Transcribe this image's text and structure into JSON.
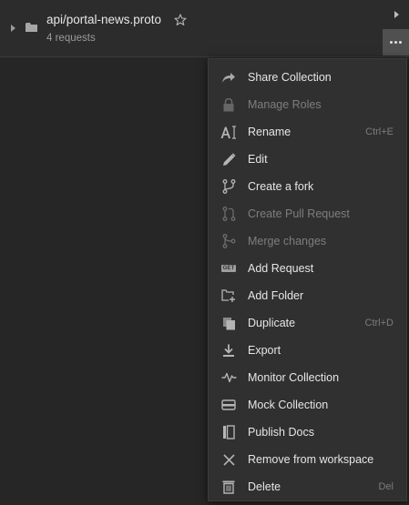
{
  "collection": {
    "name": "api/portal-news.proto",
    "request_count": "4 requests"
  },
  "menu": {
    "items": [
      {
        "label": "Share Collection",
        "shortcut": "",
        "icon": "share-icon",
        "disabled": false
      },
      {
        "label": "Manage Roles",
        "shortcut": "",
        "icon": "lock-icon",
        "disabled": true
      },
      {
        "label": "Rename",
        "shortcut": "Ctrl+E",
        "icon": "rename-icon",
        "disabled": false
      },
      {
        "label": "Edit",
        "shortcut": "",
        "icon": "pencil-icon",
        "disabled": false
      },
      {
        "label": "Create a fork",
        "shortcut": "",
        "icon": "fork-icon",
        "disabled": false
      },
      {
        "label": "Create Pull Request",
        "shortcut": "",
        "icon": "pull-request-icon",
        "disabled": true
      },
      {
        "label": "Merge changes",
        "shortcut": "",
        "icon": "merge-icon",
        "disabled": true
      },
      {
        "label": "Add Request",
        "shortcut": "",
        "icon": "get-request-icon",
        "disabled": false
      },
      {
        "label": "Add Folder",
        "shortcut": "",
        "icon": "add-folder-icon",
        "disabled": false
      },
      {
        "label": "Duplicate",
        "shortcut": "Ctrl+D",
        "icon": "duplicate-icon",
        "disabled": false
      },
      {
        "label": "Export",
        "shortcut": "",
        "icon": "export-icon",
        "disabled": false
      },
      {
        "label": "Monitor Collection",
        "shortcut": "",
        "icon": "monitor-icon",
        "disabled": false
      },
      {
        "label": "Mock Collection",
        "shortcut": "",
        "icon": "mock-server-icon",
        "disabled": false
      },
      {
        "label": "Publish Docs",
        "shortcut": "",
        "icon": "docs-icon",
        "disabled": false
      },
      {
        "label": "Remove from workspace",
        "shortcut": "",
        "icon": "close-icon",
        "disabled": false
      },
      {
        "label": "Delete",
        "shortcut": "Del",
        "icon": "trash-icon",
        "disabled": false
      }
    ],
    "get_badge_text": "GET"
  },
  "colors": {
    "background": "#262626",
    "menu_background": "#303030",
    "text": "#e6e6e6",
    "disabled_text": "#7e7e7e",
    "shortcut_text": "#7c7c7c"
  }
}
